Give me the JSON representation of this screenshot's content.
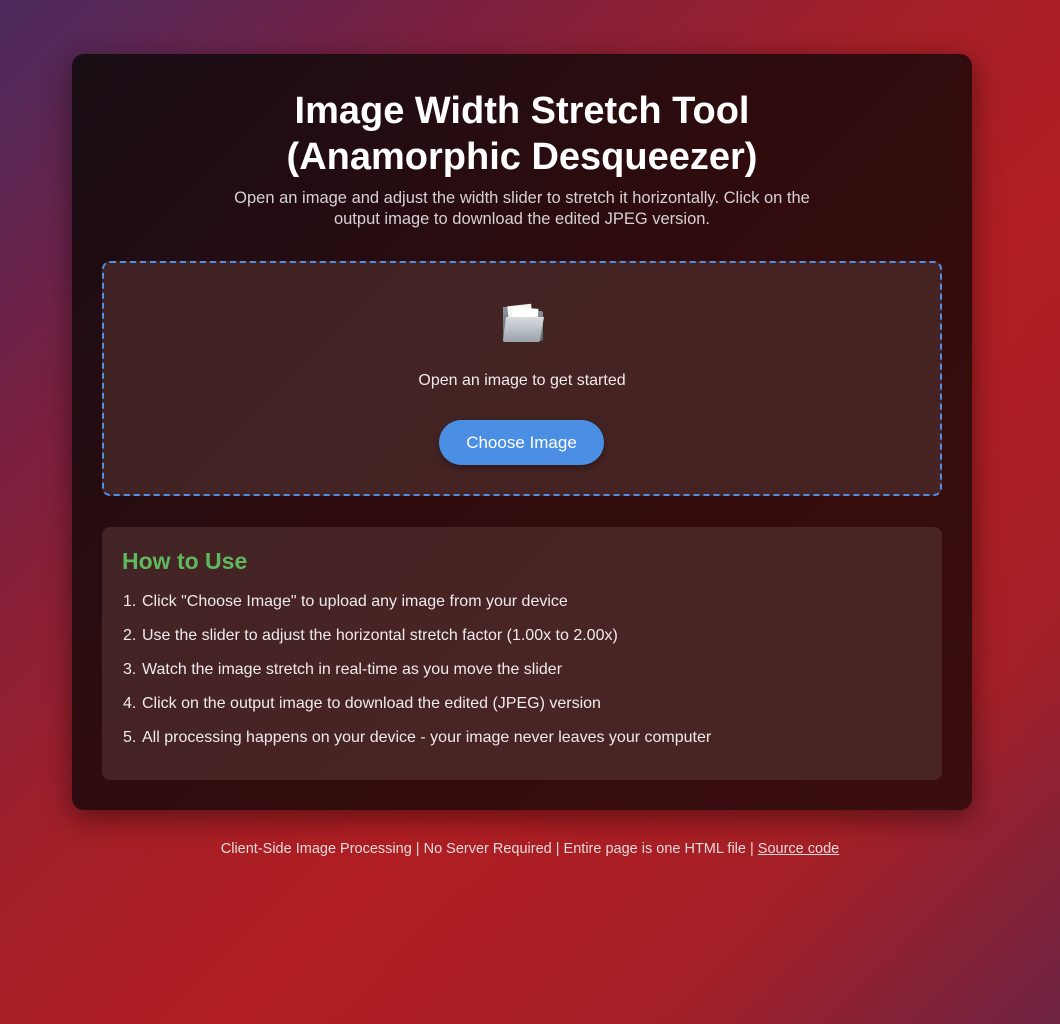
{
  "header": {
    "title_line1": "Image Width Stretch Tool",
    "title_line2": "(Anamorphic Desqueezer)",
    "subtitle": "Open an image and adjust the width slider to stretch it horizontally. Click on the output image to download the edited JPEG version."
  },
  "dropzone": {
    "icon": "folder-icon",
    "text": "Open an image to get started",
    "button_label": "Choose Image"
  },
  "howto": {
    "title": "How to Use",
    "steps": [
      {
        "num": "1.",
        "text": "Click \"Choose Image\" to upload any image from your device"
      },
      {
        "num": "2.",
        "text": "Use the slider to adjust the horizontal stretch factor (1.00x to 2.00x)"
      },
      {
        "num": "3.",
        "text": "Watch the image stretch in real-time as you move the slider"
      },
      {
        "num": "4.",
        "text": "Click on the output image to download the edited (JPEG) version"
      },
      {
        "num": "5.",
        "text": "All processing happens on your device - your image never leaves your computer"
      }
    ]
  },
  "footer": {
    "text": "Client-Side Image Processing | No Server Required | Entire page is one HTML file | ",
    "link_label": "Source code"
  },
  "colors": {
    "accent_blue": "#4a8fe4",
    "heading_green": "#5fb85b",
    "dashed_border": "#4f8fe6"
  }
}
